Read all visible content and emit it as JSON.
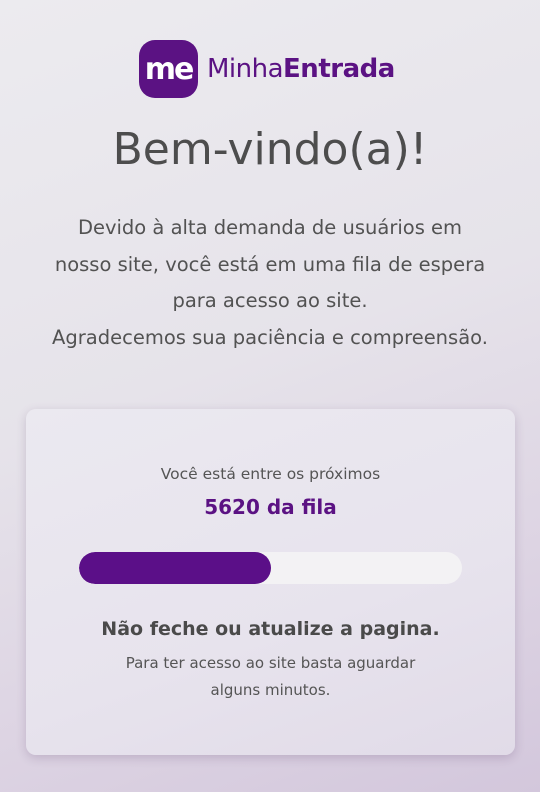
{
  "brand": {
    "mark": "me",
    "name_regular": "Minha",
    "name_bold": "Entrada",
    "color": "#5b1283"
  },
  "page": {
    "title": "Bem-vindo(a)!",
    "intro_lines": [
      "Devido à alta demanda de usuários em",
      "nosso site, você está em uma fila de espera",
      "para acesso ao site.",
      "Agradecemos sua paciência e compreensão."
    ]
  },
  "queue": {
    "lead": "Você está entre os próximos",
    "position": "5620 da fila",
    "progress_fraction": 0.5,
    "progress_color": "#5b0f88",
    "warning": "Não feche ou atualize a pagina.",
    "hint_lines": [
      "Para ter acesso ao site basta aguardar",
      "alguns minutos."
    ]
  }
}
